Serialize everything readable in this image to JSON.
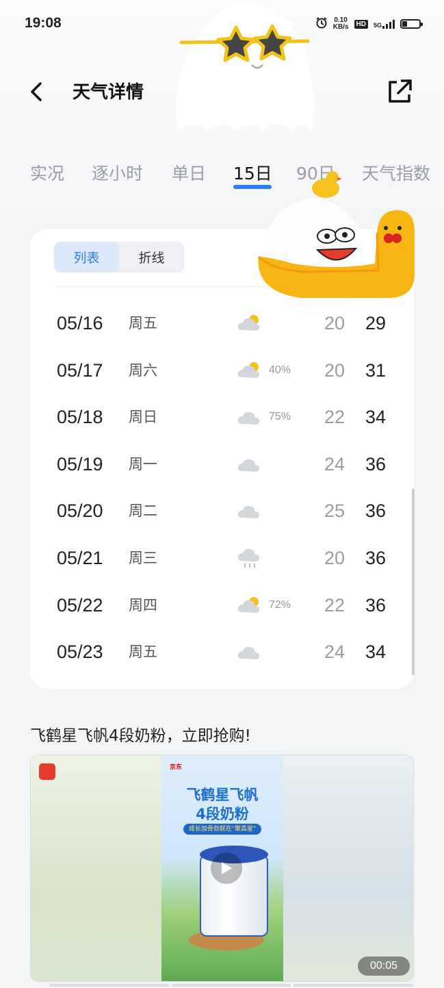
{
  "status_bar": {
    "time": "19:08",
    "net_speed_value": "0.10",
    "net_speed_unit": "KB/s",
    "hd_label": "HD",
    "signal_label": "5G",
    "battery_level": 0.3,
    "icons": [
      "alarm-icon",
      "signal-icon",
      "battery-icon"
    ]
  },
  "header": {
    "title": "天气详情",
    "back_icon": "back-chevron-icon",
    "share_icon": "share-external-icon"
  },
  "tabs": [
    {
      "label": "实况",
      "active": false
    },
    {
      "label": "逐小时",
      "active": false
    },
    {
      "label": "单日",
      "active": false
    },
    {
      "label": "15日",
      "active": true
    },
    {
      "label": "90日",
      "active": false
    },
    {
      "label": "天气指数",
      "active": false
    }
  ],
  "view_toggle": {
    "list_label": "列表",
    "line_label": "折线",
    "selected": "列表"
  },
  "forecast": [
    {
      "date": "05/16",
      "weekday": "周五",
      "icon": "partly-cloudy-icon",
      "precip": "",
      "low": "20",
      "high": "29"
    },
    {
      "date": "05/17",
      "weekday": "周六",
      "icon": "partly-cloudy-icon",
      "precip": "40%",
      "low": "20",
      "high": "31"
    },
    {
      "date": "05/18",
      "weekday": "周日",
      "icon": "cloudy-icon",
      "precip": "75%",
      "low": "22",
      "high": "34"
    },
    {
      "date": "05/19",
      "weekday": "周一",
      "icon": "cloudy-icon",
      "precip": "",
      "low": "24",
      "high": "36"
    },
    {
      "date": "05/20",
      "weekday": "周二",
      "icon": "cloudy-icon",
      "precip": "",
      "low": "25",
      "high": "36"
    },
    {
      "date": "05/21",
      "weekday": "周三",
      "icon": "rain-icon",
      "precip": "",
      "low": "20",
      "high": "36"
    },
    {
      "date": "05/22",
      "weekday": "周四",
      "icon": "partly-cloudy-icon",
      "precip": "72%",
      "low": "22",
      "high": "36"
    },
    {
      "date": "05/23",
      "weekday": "周五",
      "icon": "cloudy-icon",
      "precip": "",
      "low": "24",
      "high": "34"
    }
  ],
  "ad": {
    "title": "飞鹤星飞帆4段奶粉，立即抢购!",
    "poster_line1": "飞鹤星飞帆",
    "poster_line2": "4段奶粉",
    "poster_slogan": "成长加骨劲就在\"聚高星\"",
    "poster_brand": "京东",
    "duration": "00:05"
  },
  "colors": {
    "accent": "#2f7df6",
    "background": "#f4f5f7",
    "card": "#ffffff"
  }
}
